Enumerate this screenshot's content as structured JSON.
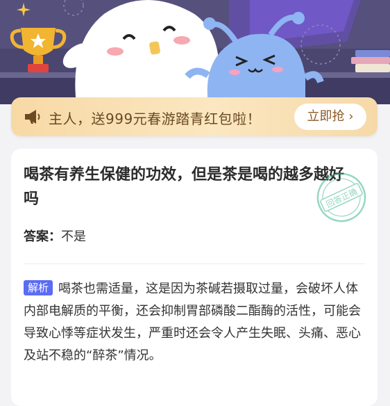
{
  "banner": {
    "text": "主人，送999元春游踏青红包啦！",
    "button_label": "立即抢 ›"
  },
  "question": {
    "title": "喝茶有养生保健的功效，但是茶是喝的越多越好吗",
    "answer_label": "答案：",
    "answer_value": "不是",
    "stamp_text": "回答正确",
    "analysis_tag": "解析",
    "analysis_text": "喝茶也需适量，这是因为茶碱若摄取过量，会破坏人体内部电解质的平衡，还会抑制胃部磷酸二酯酶的活性，可能会导致心悸等症状发生，严重时还会令人产生失眠、头痛、恶心及站不稳的“醉茶”情况。"
  },
  "colors": {
    "hero_bg": "#4a4670",
    "banner_bg": "#f8deb0",
    "tag_bg": "#5b6bf4",
    "stamp": "#3fb88c"
  },
  "icons": [
    "trophy-icon",
    "star-icon",
    "horn-icon",
    "stamp-icon"
  ]
}
